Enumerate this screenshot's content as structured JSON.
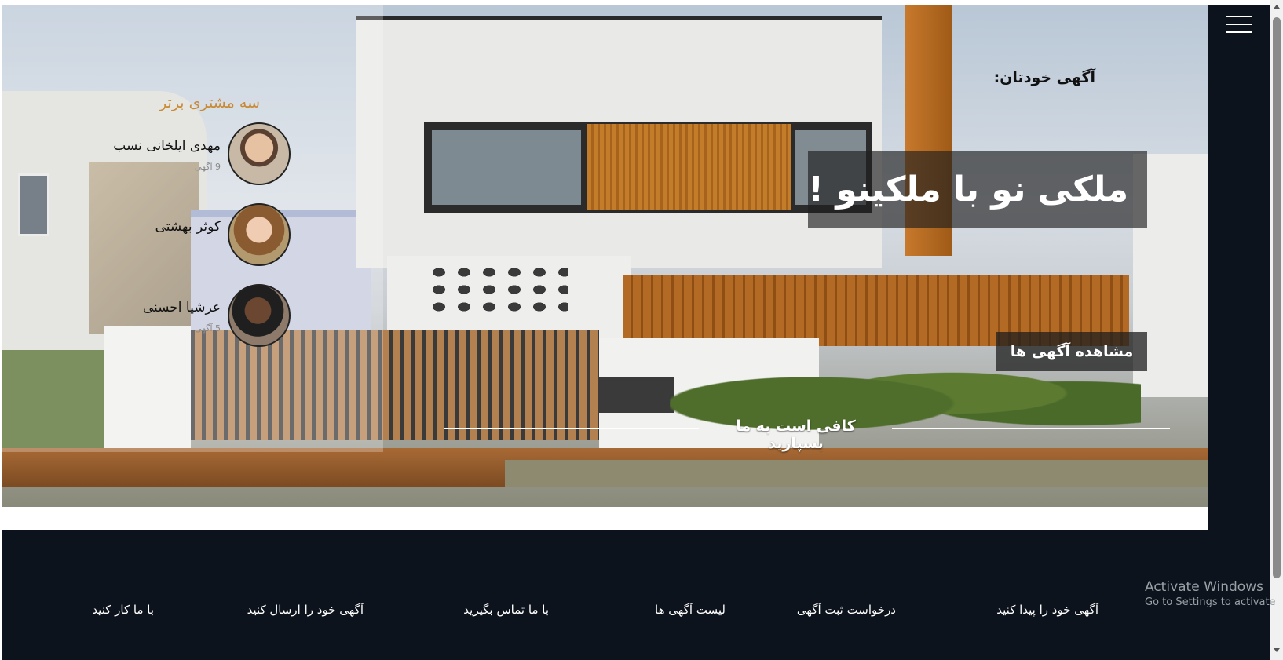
{
  "hero": {
    "ad_label": "آگهی خودتان:",
    "headline": "ملکی نو با ملکینو !",
    "view_button": "مشاهده آگهی ها",
    "slogan": "کافی است به ما بسپارید"
  },
  "top_customers": {
    "title": "سه مشتری برتر",
    "items": [
      {
        "name": "مهدی ایلخانی نسب",
        "count": "9 آگهی"
      },
      {
        "name": "کوثر بهشتی",
        "count": ""
      },
      {
        "name": "عرشیا احسنی",
        "count": "5 آگهی"
      }
    ]
  },
  "footer": {
    "links": [
      "آگهی خود را پیدا کنید",
      "درخواست ثبت آگهی",
      "لیست آگهی ها",
      "با ما تماس بگیرید",
      "آگهی خود را ارسال کنید",
      "با ما کار کنید"
    ]
  },
  "watermark": {
    "line1": "Activate Windows",
    "line2": "Go to Settings to activate"
  },
  "icons": {
    "menu": "hamburger-menu-icon"
  },
  "colors": {
    "dark_bg": "#0d131c",
    "accent_gold": "#c98a35"
  }
}
